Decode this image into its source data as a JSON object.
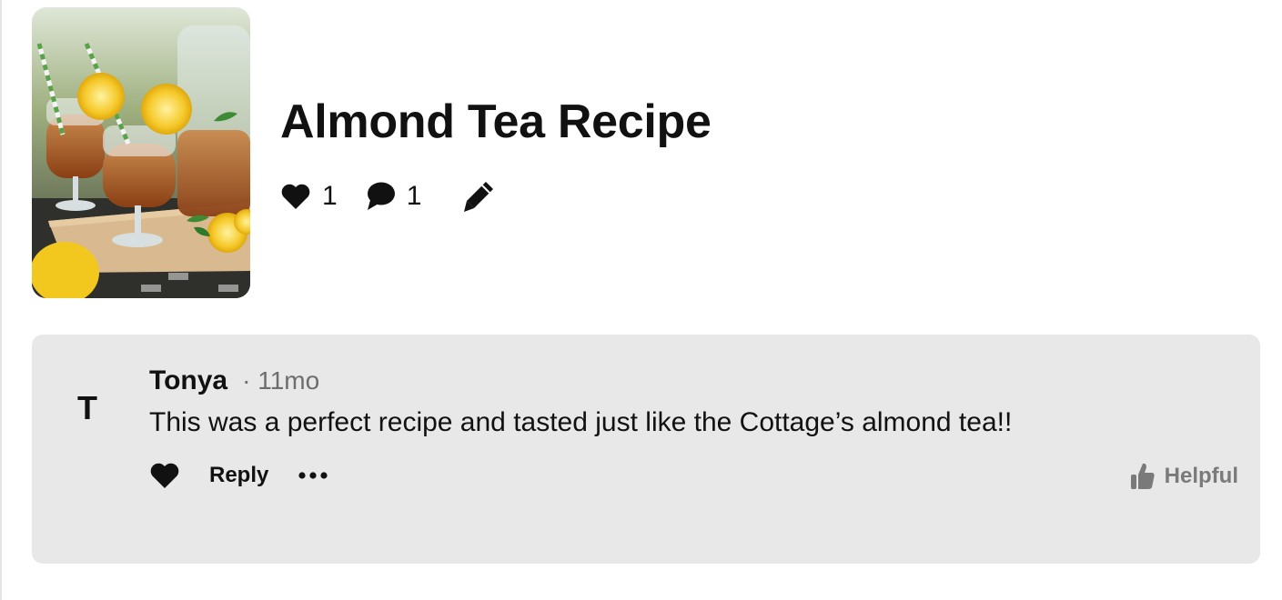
{
  "recipe": {
    "title": "Almond Tea Recipe",
    "likes": "1",
    "comments": "1"
  },
  "icons": {
    "like": "heart-icon",
    "comment": "speech-bubble-icon",
    "edit": "pencil-icon",
    "more": "ellipsis-icon",
    "helpful": "thumbs-up-icon"
  },
  "comment": {
    "avatar_initial": "T",
    "author": "Tonya",
    "meta": "· 11mo",
    "text": "This was a perfect recipe and tasted just like the Cottage’s almond tea!!",
    "reply_label": "Reply",
    "helpful_label": "Helpful"
  },
  "colors": {
    "card_background": "#e8e8e8",
    "muted_text": "#6d6d6d",
    "helpful_text": "#7a7a7a"
  }
}
